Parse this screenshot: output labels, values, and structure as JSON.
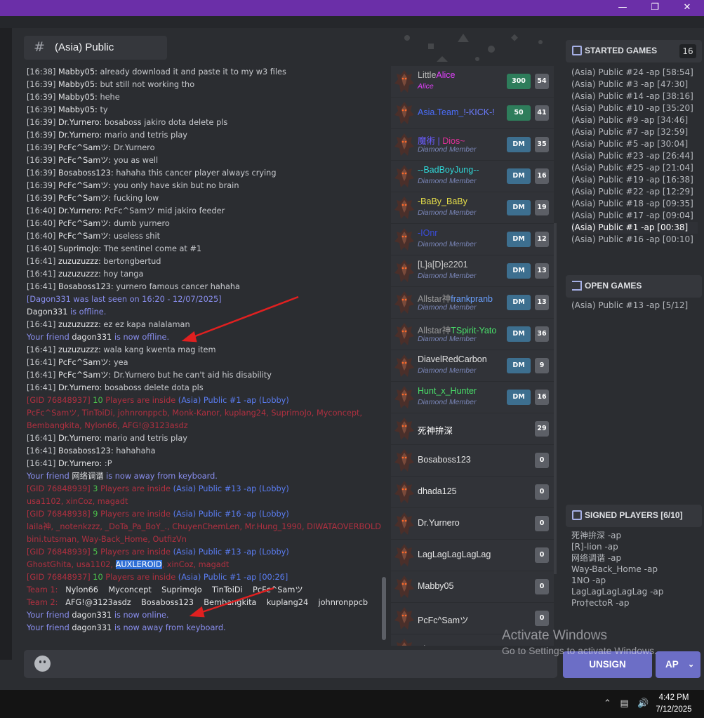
{
  "window": {
    "restore_icon": "restore-icon",
    "minimize_icon": "minimize-icon",
    "close_icon": "close-icon"
  },
  "channel": {
    "title": "(Asia) Public",
    "icon": "hash-icon"
  },
  "chat": [
    {
      "ts": "[16:38]",
      "user": "Mabby05:",
      "msg": " already download it and paste it to my w3 files"
    },
    {
      "ts": "[16:39]",
      "user": "Mabby05:",
      "msg": " but still not working tho"
    },
    {
      "ts": "[16:39]",
      "user": "Mabby05:",
      "msg": " hehe"
    },
    {
      "ts": "[16:39]",
      "user": "Mabby05:",
      "msg": " ty"
    },
    {
      "ts": "[16:39]",
      "user": "Dr.Yurnero:",
      "msg": " bosaboss jakiro dota delete pls"
    },
    {
      "ts": "[16:39]",
      "user": "Dr.Yurnero:",
      "msg": " mario and tetris play"
    },
    {
      "ts": "[16:39]",
      "user": "PcFc^Samツ:",
      "msg": " Dr.Yurnero"
    },
    {
      "ts": "[16:39]",
      "user": "PcFc^Samツ:",
      "msg": " you as well"
    },
    {
      "ts": "[16:39]",
      "user": "Bosaboss123:",
      "msg": " hahaha this cancer player always crying"
    },
    {
      "ts": "[16:39]",
      "user": "PcFc^Samツ:",
      "msg": " you only have skin but no brain"
    },
    {
      "ts": "[16:39]",
      "user": "PcFc^Samツ:",
      "msg": " fucking low"
    },
    {
      "ts": "[16:40]",
      "user": "Dr.Yurnero:",
      "msg": " PcFc^Samツ mid jakiro feeder"
    },
    {
      "ts": "[16:40]",
      "user": "PcFc^Samツ:",
      "msg": " dumb yurnero"
    },
    {
      "ts": "[16:40]",
      "user": "PcFc^Samツ:",
      "msg": " useless shit"
    },
    {
      "ts": "[16:40]",
      "user": "SuprimoJo:",
      "msg": " The sentinel come at #1"
    },
    {
      "ts": "[16:41]",
      "user": "zuzuzuzzz:",
      "msg": " bertongbertud"
    },
    {
      "ts": "[16:41]",
      "user": "zuzuzuzzz:",
      "msg": " hoy tanga"
    },
    {
      "ts": "[16:41]",
      "user": "Bosaboss123:",
      "msg": " yurnero famous cancer hahaha"
    }
  ],
  "chat_sys": {
    "last_seen": "[Dagon331 was last seen on 16:20 - 12/07/2025]",
    "offline_user": "Dagon331",
    "offline_text": " is offline.",
    "ez_ts": "[16:41]",
    "ez_user": "zuzuzuzzz:",
    "ez_msg": " ez ez kapa nalalaman",
    "friend_prefix": "Your friend ",
    "friend_name": "dagon331",
    "friend_offline": " is now offline.",
    "l1_ts": "[16:41]",
    "l1_user": "zuzuzuzzz:",
    "l1_msg": " wala kang kwenta mag item",
    "l2_ts": "[16:41]",
    "l2_user": "PcFc^Samツ:",
    "l2_msg": " yea",
    "l3_ts": "[16:41]",
    "l3_user": "PcFc^Samツ:",
    "l3_msg": " Dr.Yurnero but he can't aid his disability",
    "l4_ts": "[16:41]",
    "l4_user": "Dr.Yurnero:",
    "l4_msg": " bosaboss delete dota pls",
    "gid1": "[GID 76848937]",
    "gid1_n": " 10 ",
    "gid1_mid": "Players are inside ",
    "gid1_ch": "(Asia) Public #1 -ap (Lobby)",
    "gid1_list_a": "PcFc^Samツ, TinToiDi, johnronppcb, Monk-Kanor, kuplang24, SuprimoJo, Myconcept,",
    "gid1_list_b": "Bembangkita, Nylon66, AFG!@3123asdz",
    "l5_ts": "[16:41]",
    "l5_user": "Dr.Yurnero:",
    "l5_msg": " mario and tetris play",
    "l6_ts": "[16:41]",
    "l6_user": "Bosaboss123:",
    "l6_msg": " hahahaha",
    "l7_ts": "[16:41]",
    "l7_user": "Dr.Yurnero:",
    "l7_msg": " :P",
    "afk_name": "网络调谐",
    "afk_text": " is now away from keyboard.",
    "gid2": "[GID 76848939]",
    "gid2_n": " 3 ",
    "gid2_mid": "Players are inside ",
    "gid2_ch": "(Asia) Public #13 -ap (Lobby)",
    "gid2_list": "usa1102, xinCoz, magadt",
    "gid3": "[GID 76848938]",
    "gid3_n": " 9 ",
    "gid3_mid": "Players are inside ",
    "gid3_ch": "(Asia) Public #16 -ap (Lobby)",
    "gid3_list_a": "laila神, _notenkzzz, _DoTa_Pa_BoY_., ChuyenChemLen, Mr.Hung_1990, DIWATAOVERBOLD,",
    "gid3_list_b": "bini.tutsman, Way-Back_Home, OutfizVn",
    "gid4": "[GID 76848939]",
    "gid4_n": " 5 ",
    "gid4_mid": "Players are inside ",
    "gid4_ch": "(Asia) Public #13 -ap (Lobby)",
    "gid4_list_pre": "GhostGhita, usa1102, ",
    "gid4_hl": "AUXLEROID",
    "gid4_list_post": ", xinCoz, magadt",
    "gid5": "[GID 76848937]",
    "gid5_n": " 10 ",
    "gid5_mid": "Players are inside ",
    "gid5_ch": "(Asia) Public #1 -ap [00:26]",
    "team1_label": "Team 1:",
    "team1": "Nylon66    Myconcept    SuprimoJo    TinToiDi    PcFc^Samツ",
    "team2_label": "Team 2:",
    "team2": "AFG!@3123asdz    Bosaboss123    Bembangkita    kuplang24    johnronppcb",
    "friend_online": " is now online.",
    "friend_away": " is now away from keyboard."
  },
  "players": [
    {
      "name": "LittleAlice",
      "name_a": "Little",
      "name_b": "Alice",
      "color_a": "#b8b8b8",
      "color_b": "#e040fb",
      "sub": "Alice",
      "sub_color": "#e040fb",
      "badge": "300",
      "badge_color": "#2e7d5b",
      "level": "54"
    },
    {
      "name": "Asia.Team_!-KICK-!",
      "name_a": "Asia.Team_",
      "name_b": "!-KICK-!",
      "color_a": "#4a6cf7",
      "color_b": "#6c7cff",
      "sub": "",
      "badge": "50",
      "badge_color": "#2e7d5b",
      "level": "41"
    },
    {
      "name": "魔術 | Dios~",
      "name_a": "魔術 | ",
      "name_b": "Dios~",
      "color_a": "#6a5cff",
      "color_b": "#e0309a",
      "sub": "Diamond Member",
      "badge": "DM",
      "badge_color": "#3d6f8f",
      "level": "35"
    },
    {
      "name": "--BadBoyJung--",
      "name_a": "--BadBoyJung--",
      "name_b": "",
      "color_a": "#2fd6d6",
      "color_b": "#2fd6d6",
      "sub": "Diamond Member",
      "badge": "DM",
      "badge_color": "#3d6f8f",
      "level": "16"
    },
    {
      "name": "-BaBy_BaBy",
      "name_a": "-BaBy_BaBy",
      "name_b": "",
      "color_a": "#e8e04a",
      "color_b": "#e8e04a",
      "sub": "Diamond Member",
      "badge": "DM",
      "badge_color": "#3d6f8f",
      "level": "19"
    },
    {
      "name": "-IOnr",
      "name_a": "-IOnr",
      "name_b": "",
      "color_a": "#3a4cd6",
      "color_b": "#3a4cd6",
      "sub": "Diamond Member",
      "badge": "DM",
      "badge_color": "#3d6f8f",
      "level": "12"
    },
    {
      "name": "[L]a[D]e2201",
      "name_a": "[L]a[D]e2201",
      "name_b": "",
      "color_a": "#c8c8c8",
      "color_b": "#c8c8c8",
      "sub": "Diamond Member",
      "badge": "DM",
      "badge_color": "#3d6f8f",
      "level": "13"
    },
    {
      "name": "Allstar神frankpranb",
      "name_a": "Allstar神",
      "name_b": "frankpranb",
      "color_a": "#9a9a9a",
      "color_b": "#6aa0ff",
      "sub": "Diamond Member",
      "badge": "DM",
      "badge_color": "#3d6f8f",
      "level": "13"
    },
    {
      "name": "Allstar神TSpirit-Yato",
      "name_a": "Allstar神",
      "name_b": "TSpirit-Yato",
      "color_a": "#9a9a9a",
      "color_b": "#49e06a",
      "sub": "Diamond Member",
      "badge": "DM",
      "badge_color": "#3d6f8f",
      "level": "36"
    },
    {
      "name": "DiavelRedCarbon",
      "name_a": "DiavelRedCarbon",
      "name_b": "",
      "color_a": "#e6e6e6",
      "color_b": "#e6e6e6",
      "sub": "Diamond Member",
      "badge": "DM",
      "badge_color": "#3d6f8f",
      "level": "9"
    },
    {
      "name": "Hunt_x_Hunter",
      "name_a": "Hunt_x_Hunter",
      "name_b": "",
      "color_a": "#49e06a",
      "color_b": "#49e06a",
      "sub": "Diamond Member",
      "badge": "DM",
      "badge_color": "#3d6f8f",
      "level": "16"
    },
    {
      "name": "死神拚深",
      "name_a": "死神拚深",
      "name_b": "",
      "color_a": "#ffffff",
      "color_b": "#ffffff",
      "sub": "",
      "badge": "",
      "level": "29"
    },
    {
      "name": "Bosaboss123",
      "name_a": "Bosaboss123",
      "name_b": "",
      "color_a": "#e6e6e6",
      "color_b": "#e6e6e6",
      "sub": "",
      "badge": "",
      "level": "0"
    },
    {
      "name": "dhada125",
      "name_a": "dhada125",
      "name_b": "",
      "color_a": "#e6e6e6",
      "color_b": "#e6e6e6",
      "sub": "",
      "badge": "",
      "level": "0"
    },
    {
      "name": "Dr.Yurnero",
      "name_a": "Dr.Yurnero",
      "name_b": "",
      "color_a": "#e6e6e6",
      "color_b": "#e6e6e6",
      "sub": "",
      "badge": "",
      "level": "0"
    },
    {
      "name": "LagLagLagLagLag",
      "name_a": "LagLagLagLagLag",
      "name_b": "",
      "color_a": "#e6e6e6",
      "color_b": "#e6e6e6",
      "sub": "",
      "badge": "",
      "level": "0"
    },
    {
      "name": "Mabby05",
      "name_a": "Mabby05",
      "name_b": "",
      "color_a": "#e6e6e6",
      "color_b": "#e6e6e6",
      "sub": "",
      "badge": "",
      "level": "0"
    },
    {
      "name": "PcFc^Samツ",
      "name_a": "PcFc^Samツ",
      "name_b": "",
      "color_a": "#e6e6e6",
      "color_b": "#e6e6e6",
      "sub": "",
      "badge": "",
      "level": "0"
    },
    {
      "name": "Phoo",
      "name_a": "Phoo",
      "name_b": "",
      "color_a": "#e6e6e6",
      "color_b": "#e6e6e6",
      "sub": "",
      "badge": "",
      "level": ""
    }
  ],
  "started_games": {
    "title": "STARTED GAMES",
    "count": "16",
    "icon": "checkbox-icon",
    "items": [
      "(Asia) Public #24 -ap [58:54]",
      "(Asia) Public #3 -ap [47:30]",
      "(Asia) Public #14 -ap [38:16]",
      "(Asia) Public #10 -ap [35:20]",
      "(Asia) Public #9 -ap [34:46]",
      "(Asia) Public #7 -ap [32:59]",
      "(Asia) Public #5 -ap [30:04]",
      "(Asia) Public #23 -ap [26:44]",
      "(Asia) Public #25 -ap [21:04]",
      "(Asia) Public #19 -ap [16:38]",
      "(Asia) Public #22 -ap [12:29]",
      "(Asia) Public #18 -ap [09:35]",
      "(Asia) Public #17 -ap [09:04]",
      "(Asia) Public #1 -ap [00:38]",
      "(Asia) Public #16 -ap [00:10]"
    ],
    "selected_index": 13
  },
  "open_games": {
    "title": "OPEN GAMES",
    "icon": "enter-icon",
    "items": [
      "(Asia) Public #13 -ap [5/12]"
    ]
  },
  "signed_players": {
    "title": "SIGNED PLAYERS [6/10]",
    "icon": "edit-icon",
    "items": [
      "死神拚深 -ap",
      "[R]-lion -ap",
      "网络调谐 -ap",
      "Way-Back_Home -ap",
      "1NO -ap",
      "LagLagLagLagLag -ap",
      "Pro†ectoR -ap"
    ]
  },
  "buttons": {
    "unsign": "UNSIGN",
    "ap": "AP"
  },
  "watermark": {
    "line1": "Activate Windows",
    "line2": "Go to Settings to activate Windows."
  },
  "taskbar": {
    "time": "4:42 PM",
    "date": "7/12/2025"
  }
}
